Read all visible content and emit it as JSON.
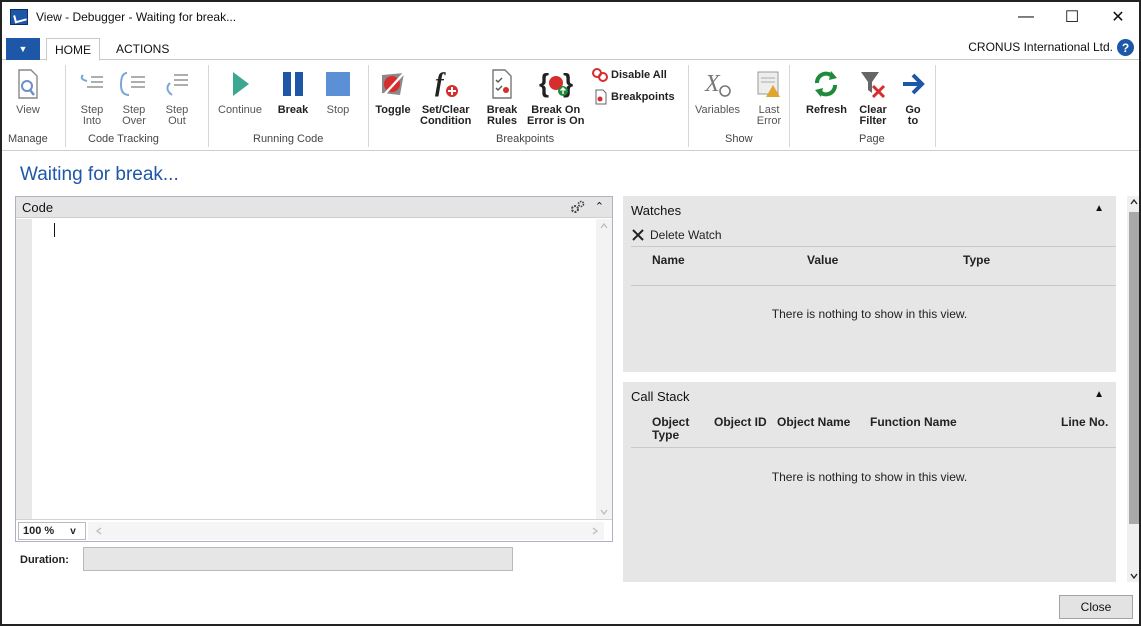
{
  "window": {
    "title": "View - Debugger - Waiting for break...",
    "minimize": "—",
    "maximize": "☐",
    "close": "✕"
  },
  "tabs": [
    {
      "label": "HOME",
      "active": true
    },
    {
      "label": "ACTIONS",
      "active": false
    }
  ],
  "menu_glyph": "▼",
  "company": "CRONUS International Ltd.",
  "help_glyph": "?",
  "ribbon": {
    "groups": {
      "manage": "Manage",
      "code_tracking": "Code Tracking",
      "running_code": "Running Code",
      "breakpoints": "Breakpoints",
      "show": "Show",
      "page": "Page"
    },
    "buttons": {
      "view": "View",
      "step_into_1": "Step",
      "step_into_2": "Into",
      "step_over_1": "Step",
      "step_over_2": "Over",
      "step_out_1": "Step",
      "step_out_2": "Out",
      "continue": "Continue",
      "break": "Break",
      "stop": "Stop",
      "toggle": "Toggle",
      "set_clear_1": "Set/Clear",
      "set_clear_2": "Condition",
      "break_rules_1": "Break",
      "break_rules_2": "Rules",
      "break_on_error_1": "Break On",
      "break_on_error_2": "Error is On",
      "disable_all": "Disable All",
      "breakpoints": "Breakpoints",
      "variables": "Variables",
      "last_error_1": "Last",
      "last_error_2": "Error",
      "refresh": "Refresh",
      "clear_filter_1": "Clear",
      "clear_filter_2": "Filter",
      "go_to_1": "Go",
      "go_to_2": "to"
    }
  },
  "page_title": "Waiting for break...",
  "code_panel": {
    "title": "Code",
    "zoom": "100 %",
    "zoom_arrow": "v"
  },
  "duration_label": "Duration:",
  "watches": {
    "title": "Watches",
    "delete_label": "Delete Watch",
    "columns": [
      "Name",
      "Value",
      "Type"
    ],
    "empty": "There is nothing to show in this view."
  },
  "call_stack": {
    "title": "Call Stack",
    "columns": [
      "Object Type",
      "Object ID",
      "Object Name",
      "Function Name",
      "Line No."
    ],
    "empty": "There is nothing to show in this view."
  },
  "close_button": "Close",
  "colors": {
    "accent": "#1e56a8",
    "panel_bg": "#e6e6e6",
    "play_green": "#3ca893",
    "pause_blue": "#1e56a8",
    "stop_blue": "#5b8fd6",
    "breakpoint_red": "#d62d2d",
    "refresh_green": "#1f8b3a"
  }
}
